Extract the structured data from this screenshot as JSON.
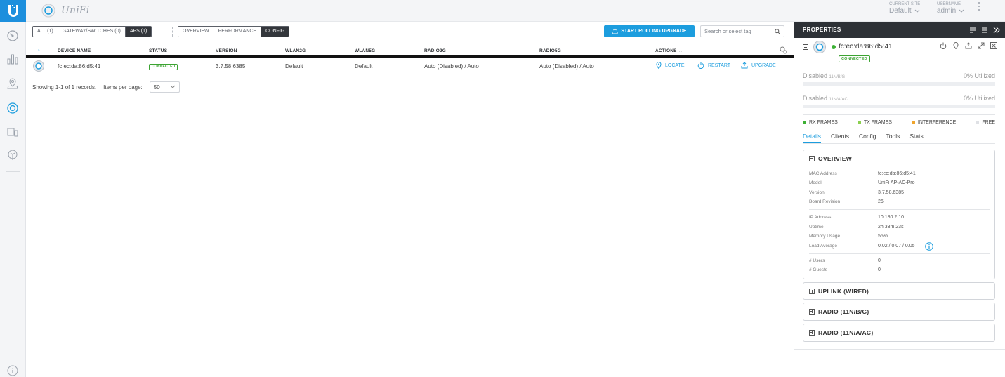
{
  "app": {
    "brand": "UniFi"
  },
  "topbar": {
    "site_label": "CURRENT SITE",
    "site_value": "Default",
    "user_label": "USERNAME",
    "user_value": "admin"
  },
  "filters": {
    "device_types": [
      "ALL (1)",
      "GATEWAY/SWITCHES (0)",
      "APS (1)"
    ],
    "active_type": "APS (1)",
    "views": [
      "OVERVIEW",
      "PERFORMANCE",
      "CONFIG"
    ],
    "active_view": "CONFIG"
  },
  "rolling_upgrade_label": "START ROLLING UPGRADE",
  "search": {
    "placeholder": "Search or select tag"
  },
  "table": {
    "sort_indicator": "↑",
    "columns": [
      "DEVICE NAME",
      "STATUS",
      "VERSION",
      "WLAN2G",
      "WLAN5G",
      "RADIO2G",
      "RADIO5G",
      "ACTIONS ↔"
    ],
    "rows": [
      {
        "device_name": "fc:ec:da:86:d5:41",
        "status": "CONNECTED",
        "version": "3.7.58.6385",
        "wlan2g": "Default",
        "wlan5g": "Default",
        "radio2g": "Auto (Disabled)  / Auto",
        "radio5g": "Auto (Disabled)  / Auto",
        "actions": [
          "LOCATE",
          "RESTART",
          "UPGRADE"
        ]
      }
    ]
  },
  "footer": {
    "records_text": "Showing 1-1 of 1 records.",
    "per_page_label": "Items per page:",
    "per_page_value": "50"
  },
  "panel": {
    "title": "PROPERTIES",
    "device_name": "fc:ec:da:86:d5:41",
    "device_status": "CONNECTED",
    "radios": [
      {
        "state": "Disabled",
        "band": "11N/B/G",
        "utilization": "0% Utilized",
        "fill": 0
      },
      {
        "state": "Disabled",
        "band": "11N/A/AC",
        "utilization": "0% Utilized",
        "fill": 0
      }
    ],
    "legend": [
      {
        "label": "RX FRAMES",
        "color": "#3cb034"
      },
      {
        "label": "TX FRAMES",
        "color": "#8bcf4f"
      },
      {
        "label": "INTERFERENCE",
        "color": "#f0a52d"
      },
      {
        "label": "FREE",
        "color": "#dfe1e5"
      }
    ],
    "tabs": [
      "Details",
      "Clients",
      "Config",
      "Tools",
      "Stats"
    ],
    "active_tab": "Details",
    "overview_title": "OVERVIEW",
    "overview": {
      "mac_label": "MAC Address",
      "mac": "fc:ec:da:86:d5:41",
      "model_label": "Model",
      "model": "UniFi AP-AC-Pro",
      "version_label": "Version",
      "version": "3.7.58.6385",
      "board_label": "Board Revision",
      "board": "26",
      "ip_label": "IP Address",
      "ip": "10.180.2.10",
      "uptime_label": "Uptime",
      "uptime": "2h 33m 23s",
      "memory_label": "Memory Usage",
      "memory": "55%",
      "load_label": "Load Average",
      "load": "0.02 / 0.07 / 0.05",
      "users_label": "# Users",
      "users": "0",
      "guests_label": "# Guests",
      "guests": "0"
    },
    "sections": [
      "UPLINK (WIRED)",
      "RADIO (11N/B/G)",
      "RADIO (11N/A/AC)"
    ]
  },
  "colors": {
    "accent": "#1c9dde",
    "connected": "#3ca332",
    "dark": "#2d3136"
  }
}
